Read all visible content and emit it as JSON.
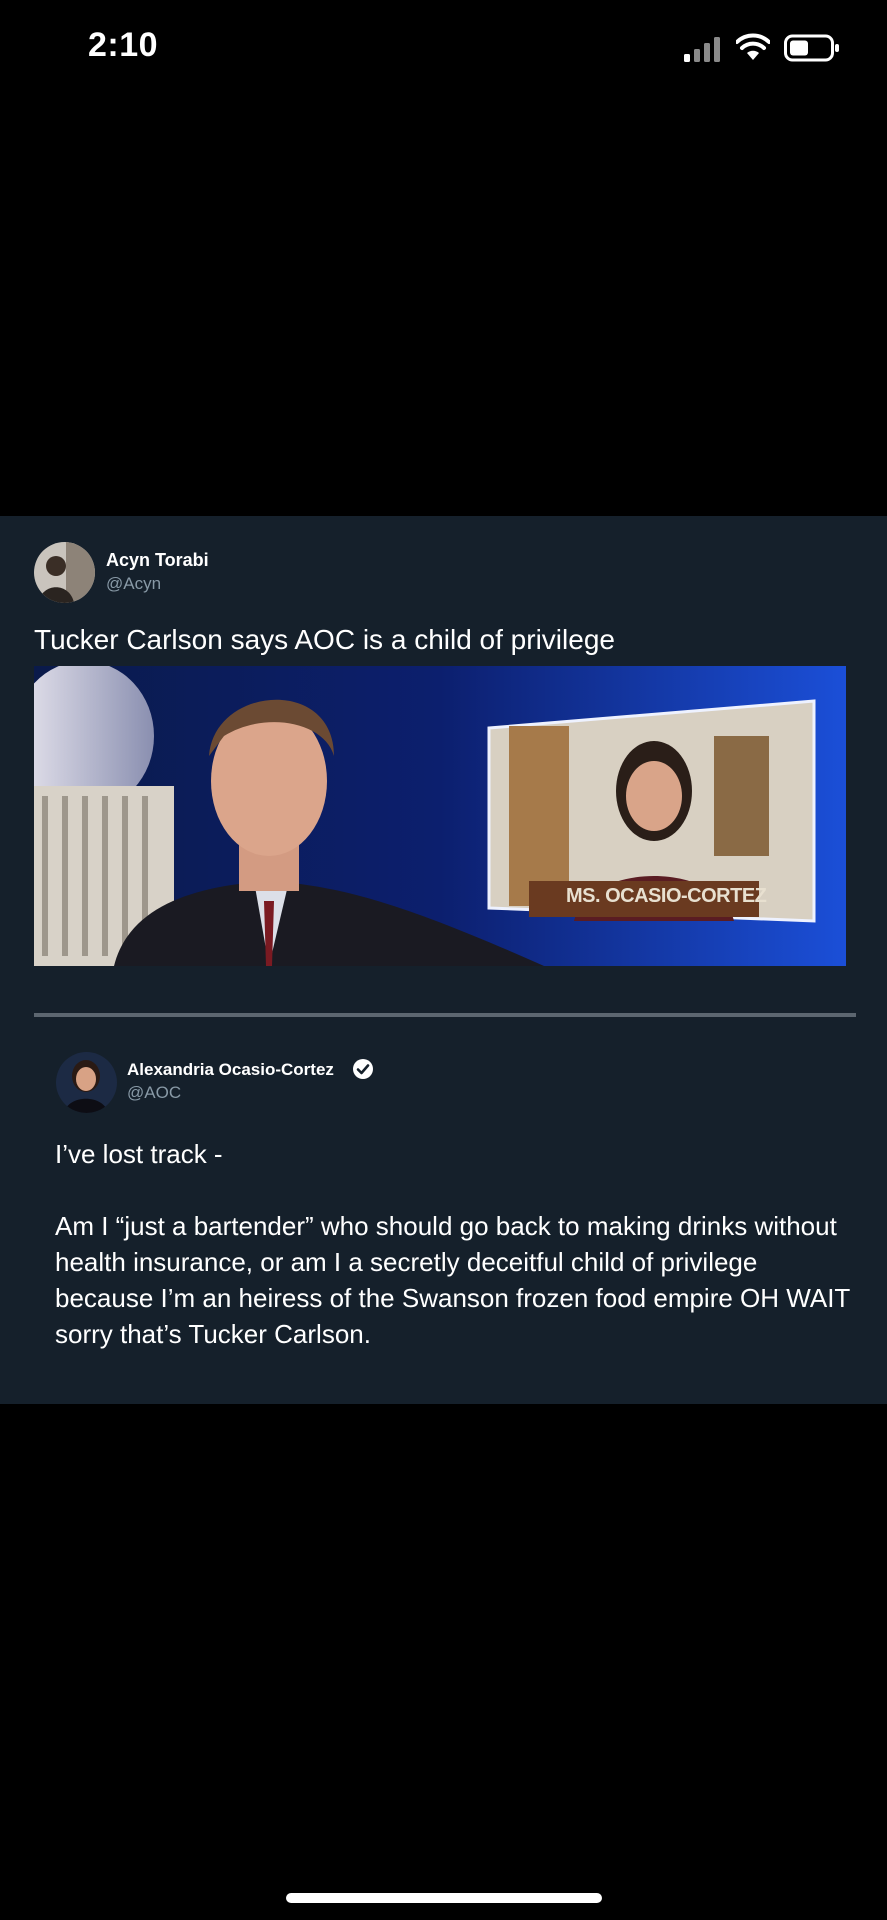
{
  "status_bar": {
    "time": "2:10",
    "battery_icon": "battery-icon",
    "wifi_icon": "wifi-icon",
    "signal_icon": "cellular-signal-icon"
  },
  "quoted_tweet": {
    "author_name": "Acyn Torabi",
    "author_handle": "@Acyn",
    "text": "Tucker Carlson says AOC is a child of privilege",
    "media": {
      "nameplate": "MS. OCASIO-CORTEZ"
    }
  },
  "reply_tweet": {
    "author_name": "Alexandria Ocasio-Cortez",
    "author_handle": "@AOC",
    "verified_icon": "verified-badge-icon",
    "line1": "I’ve lost track -",
    "line2": "Am I “just a bartender” who should go back to making drinks without health insurance, or am I a secretly deceitful child of privilege because I’m an heiress of the Swanson frozen food empire OH WAIT sorry that’s Tucker Carlson."
  },
  "colors": {
    "background": "#000000",
    "card": "#15202b",
    "secondary_text": "#8899a6",
    "divider": "#5c6670"
  }
}
